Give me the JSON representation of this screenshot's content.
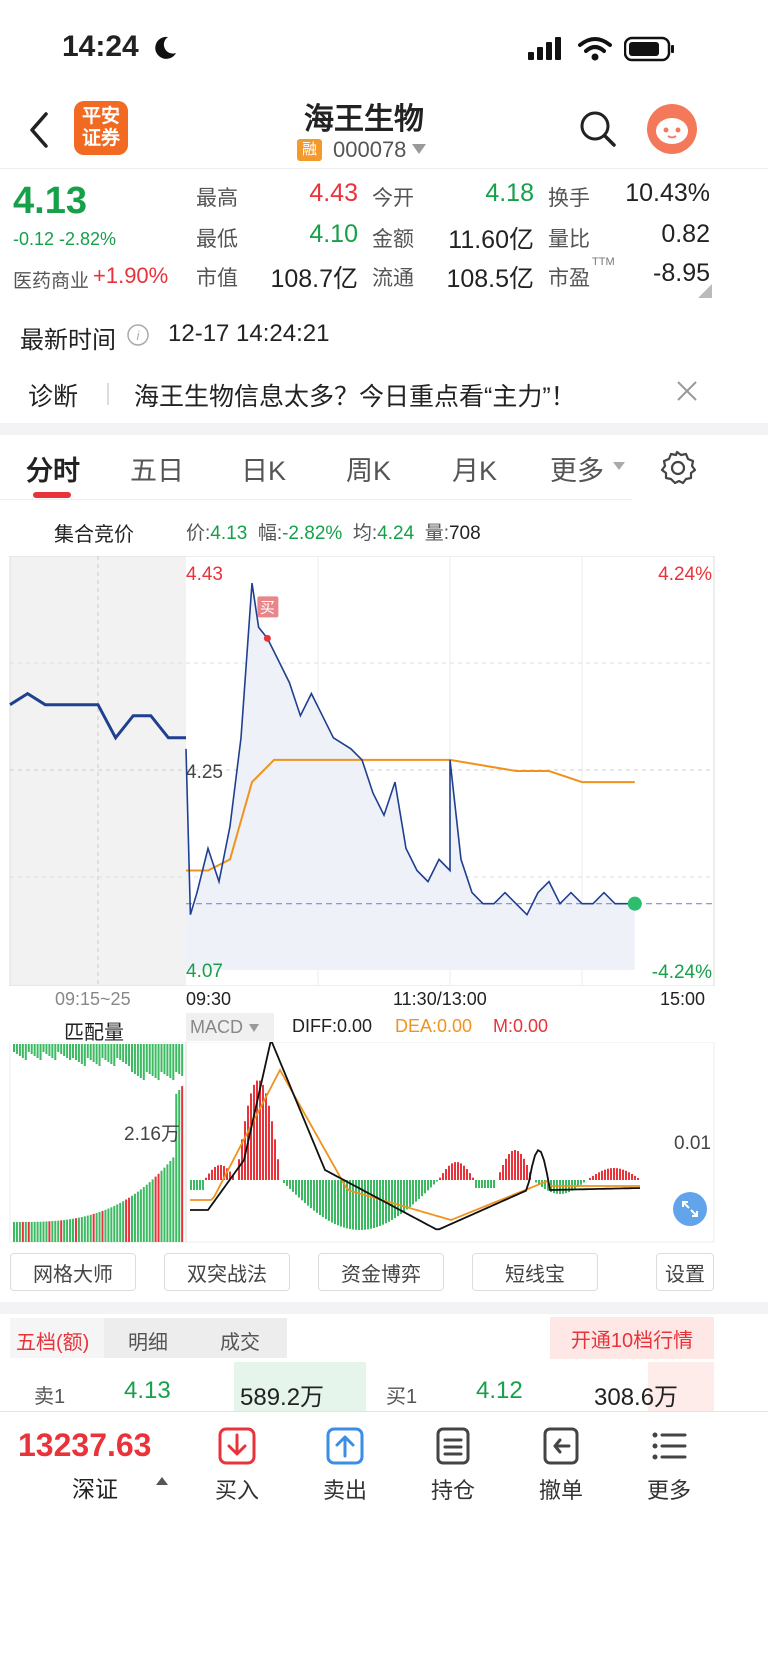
{
  "status_bar": {
    "time": "14:24",
    "moon_icon": "moon-icon",
    "signal_icon": "signal-icon",
    "wifi_icon": "wifi-icon",
    "battery_icon": "battery-icon"
  },
  "header": {
    "back_icon": "chevron-left-icon",
    "logo_line1": "平安",
    "logo_line2": "证券",
    "stock_name": "海王生物",
    "margin_badge": "融",
    "stock_code": "000078",
    "search_icon": "search-icon",
    "assistant_icon": "assistant-avatar-icon"
  },
  "quote": {
    "price": "4.13",
    "change": "-0.12 -2.82%",
    "sector_label": "医药商业",
    "sector_change": "+1.90%",
    "rows": [
      [
        {
          "label": "最高",
          "value": "4.43",
          "tone": "red"
        },
        {
          "label": "今开",
          "value": "4.18",
          "tone": "green"
        },
        {
          "label": "换手",
          "value": "10.43%",
          "tone": "plain"
        }
      ],
      [
        {
          "label": "最低",
          "value": "4.10",
          "tone": "green"
        },
        {
          "label": "金额",
          "value": "11.60亿",
          "tone": "plain"
        },
        {
          "label": "量比",
          "value": "0.82",
          "tone": "plain"
        }
      ],
      [
        {
          "label": "市值",
          "value": "108.7亿",
          "tone": "plain"
        },
        {
          "label": "流通",
          "value": "108.5亿",
          "tone": "plain"
        },
        {
          "label": "市盈",
          "value": "-8.95",
          "tone": "plain",
          "sup": "TTM"
        }
      ]
    ]
  },
  "latest_time": {
    "label": "最新时间",
    "value": "12-17 14:24:21"
  },
  "diagnosis": {
    "label": "诊断",
    "text": "海王生物信息太多？今日重点看“主力”！"
  },
  "tabs": [
    "分时",
    "五日",
    "日K",
    "周K",
    "月K",
    "更多"
  ],
  "chart_header": {
    "auction_label": "集合竞价",
    "price_label": "价:",
    "price_value": "4.13",
    "amp_label": "幅:",
    "amp_value": "-2.82%",
    "avg_label": "均:",
    "avg_value": "4.24",
    "vol_label": "量:",
    "vol_value": "708"
  },
  "chart_data": {
    "type": "line",
    "series": [
      {
        "name": "价"
      },
      {
        "name": "均"
      }
    ],
    "ylim": [
      4.07,
      4.43
    ],
    "y_ticks_left": [
      "4.43",
      "4.25",
      "4.07"
    ],
    "y_ticks_right": [
      "4.24%",
      "-4.24%"
    ],
    "x_ticks": [
      "09:15~25",
      "09:30",
      "11:30/13:00",
      "15:00"
    ],
    "price_line": [
      [
        "09:15",
        4.31
      ],
      [
        "09:16",
        4.32
      ],
      [
        "09:17",
        4.31
      ],
      [
        "09:20",
        4.31
      ],
      [
        "09:21",
        4.28
      ],
      [
        "09:22",
        4.3
      ],
      [
        "09:23",
        4.3
      ],
      [
        "09:24",
        4.28
      ],
      [
        "09:25",
        4.28
      ],
      [
        "09:30",
        4.27
      ],
      [
        "09:32",
        4.12
      ],
      [
        "09:35",
        4.14
      ],
      [
        "09:40",
        4.18
      ],
      [
        "09:45",
        4.15
      ],
      [
        "09:50",
        4.2
      ],
      [
        "09:55",
        4.28
      ],
      [
        "10:00",
        4.42
      ],
      [
        "10:03",
        4.38
      ],
      [
        "10:07",
        4.37
      ],
      [
        "10:12",
        4.35
      ],
      [
        "10:17",
        4.33
      ],
      [
        "10:22",
        4.3
      ],
      [
        "10:27",
        4.32
      ],
      [
        "10:32",
        4.3
      ],
      [
        "10:37",
        4.28
      ],
      [
        "10:45",
        4.27
      ],
      [
        "10:50",
        4.26
      ],
      [
        "10:55",
        4.23
      ],
      [
        "11:00",
        4.21
      ],
      [
        "11:05",
        4.24
      ],
      [
        "11:10",
        4.18
      ],
      [
        "11:15",
        4.16
      ],
      [
        "11:20",
        4.15
      ],
      [
        "11:25",
        4.17
      ],
      [
        "11:30",
        4.16
      ],
      [
        "13:00",
        4.26
      ],
      [
        "13:05",
        4.17
      ],
      [
        "13:10",
        4.14
      ],
      [
        "13:15",
        4.13
      ],
      [
        "13:20",
        4.13
      ],
      [
        "13:25",
        4.14
      ],
      [
        "13:30",
        4.13
      ],
      [
        "13:35",
        4.12
      ],
      [
        "13:40",
        4.14
      ],
      [
        "13:45",
        4.15
      ],
      [
        "13:50",
        4.13
      ],
      [
        "13:55",
        4.14
      ],
      [
        "14:00",
        4.13
      ],
      [
        "14:05",
        4.13
      ],
      [
        "14:10",
        4.14
      ],
      [
        "14:15",
        4.13
      ],
      [
        "14:20",
        4.13
      ],
      [
        "14:24",
        4.13
      ]
    ],
    "avg_line": [
      [
        "09:30",
        4.16
      ],
      [
        "09:40",
        4.16
      ],
      [
        "09:50",
        4.17
      ],
      [
        "10:00",
        4.24
      ],
      [
        "10:10",
        4.26
      ],
      [
        "10:30",
        4.26
      ],
      [
        "11:30",
        4.26
      ],
      [
        "13:00",
        4.26
      ],
      [
        "13:30",
        4.25
      ],
      [
        "13:45",
        4.25
      ],
      [
        "14:00",
        4.24
      ],
      [
        "14:24",
        4.24
      ]
    ],
    "buy_marker": "买",
    "prev_close": 4.25
  },
  "sub_chart": {
    "match_label": "匹配量",
    "indicator": "MACD",
    "diff_label": "DIFF:0.00",
    "dea_label": "DEA:0.00",
    "m_label": "M:0.00",
    "vol_tick": "2.16万",
    "macd_tick": "0.01"
  },
  "strategies": [
    "网格大师",
    "双突战法",
    "资金博弈",
    "短线宝",
    "设置"
  ],
  "order_tabs": [
    "五档(额)",
    "明细",
    "成交"
  ],
  "upgrade_label": "开通10档行情",
  "order_book": {
    "sell_label": "卖1",
    "sell_price": "4.13",
    "sell_amount": "589.2万",
    "buy_label": "买1",
    "buy_price": "4.12",
    "buy_amount": "308.6万"
  },
  "index": {
    "value": "13237.63",
    "name": "深证"
  },
  "bottom_nav": [
    {
      "label": "买入",
      "icon": "buy-icon"
    },
    {
      "label": "卖出",
      "icon": "sell-icon"
    },
    {
      "label": "持仓",
      "icon": "position-icon"
    },
    {
      "label": "撤单",
      "icon": "cancel-order-icon"
    },
    {
      "label": "更多",
      "icon": "menu-icon"
    }
  ],
  "colors": {
    "red": "#e8333b",
    "green": "#17a04a",
    "price_line": "#1f3f8f",
    "avg_line": "#f0931e",
    "accent_blue": "#3a8ee6"
  }
}
